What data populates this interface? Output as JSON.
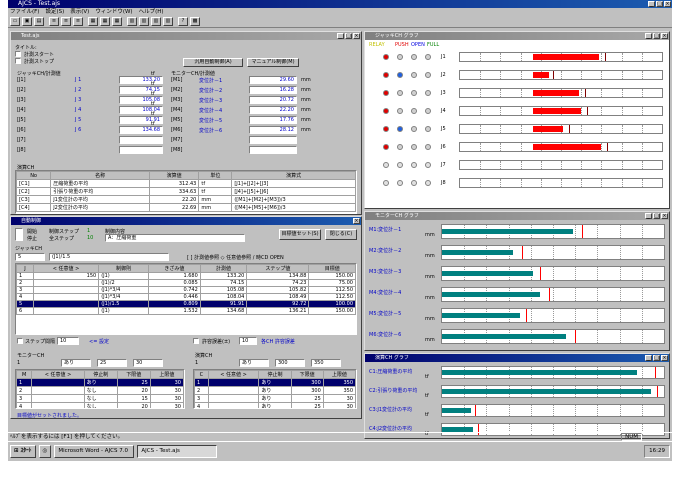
{
  "app": {
    "title": "AJCS - Test.ajs",
    "menus": [
      "ファイル(F)",
      "設定(S)",
      "表示(V)",
      "ウィンドウ(W)",
      "ヘルプ(H)"
    ]
  },
  "main_win": {
    "title": "Test.ajs",
    "label_title": "タイトル:",
    "buttons": {
      "start": "計測スタート",
      "stop": "計測ストップ",
      "auto": "汎用自動制御(A)",
      "manual": "マニュアル制御(M)"
    },
    "jack_header": "ジャッキCH/計測値",
    "monitor_header": "モニターCH/計測値",
    "jacks": [
      {
        "id": "[J1]",
        "name": "J 1",
        "value": "133.20",
        "unit": "tf"
      },
      {
        "id": "[J2]",
        "name": "J 2",
        "value": "74.15",
        "unit": "tf"
      },
      {
        "id": "[J3]",
        "name": "J 3",
        "value": "105.08",
        "unit": "tf"
      },
      {
        "id": "[J4]",
        "name": "J 4",
        "value": "108.04",
        "unit": "tf"
      },
      {
        "id": "[J5]",
        "name": "J 5",
        "value": "91.91",
        "unit": "tf"
      },
      {
        "id": "[J6]",
        "name": "J 6",
        "value": "134.68",
        "unit": "tf"
      },
      {
        "id": "[J7]",
        "name": "",
        "value": "",
        "unit": ""
      },
      {
        "id": "[J8]",
        "name": "",
        "value": "",
        "unit": ""
      }
    ],
    "monitors": [
      {
        "id": "[M1]",
        "name": "変位計－1",
        "value": "29.60",
        "unit": "mm"
      },
      {
        "id": "[M2]",
        "name": "変位計－2",
        "value": "16.28",
        "unit": "mm"
      },
      {
        "id": "[M3]",
        "name": "変位計－3",
        "value": "20.72",
        "unit": "mm"
      },
      {
        "id": "[M4]",
        "name": "変位計－4",
        "value": "22.20",
        "unit": "mm"
      },
      {
        "id": "[M5]",
        "name": "変位計－5",
        "value": "17.76",
        "unit": "mm"
      },
      {
        "id": "[M6]",
        "name": "変位計－6",
        "value": "28.12",
        "unit": "mm"
      },
      {
        "id": "[M7]",
        "name": "",
        "value": "",
        "unit": ""
      },
      {
        "id": "[M8]",
        "name": "",
        "value": "",
        "unit": ""
      }
    ],
    "calc_header": "演算CH",
    "calc_cols": [
      "No",
      "名称",
      "演算値",
      "単位",
      "演算式"
    ],
    "calc_rows": [
      [
        "[C1]",
        "圧縮荷重の平均",
        "312.43",
        "tf",
        "[J1]+[J2]+[J3]"
      ],
      [
        "[C2]",
        "引張り荷重の平均",
        "334.63",
        "tf",
        "[J4]+[J5]+[J6]"
      ],
      [
        "[C3]",
        "J1変位計の平均",
        "22.20",
        "mm",
        "([M1]+[M2]+[M3])/3"
      ],
      [
        "[C4]",
        "J2変位計の平均",
        "22.69",
        "mm",
        "([M4]+[M5]+[M6])/3"
      ]
    ]
  },
  "auto_win": {
    "title": "自動制御",
    "start": "開始",
    "stop": "停止",
    "mode_label": "制御ステップ",
    "step_label": "全ステップ",
    "step_cur": "1",
    "step_total": "10",
    "pattern_label": "制御内容",
    "pattern": "A：圧縮荷重",
    "target_btn": "目標値セット(S)",
    "close_btn": "閉じる(C)",
    "jack_ch": "ジャッキCH",
    "formula_no": "5",
    "formula": "(J1)/1.5",
    "options": "[ ] 計測値参照 ◇ 任意値参照 / 時CD OPEN",
    "cols": [
      "J",
      "< 任意値 >",
      "制御則",
      "きざみ値",
      "計測値",
      "ステップ値",
      "目標値"
    ],
    "rows": [
      [
        "1",
        "150",
        "(J1)",
        "1.680",
        "133.20",
        "134.88",
        "150.00"
      ],
      [
        "2",
        "",
        "(J1)/2",
        "0.085",
        "74.15",
        "74.23",
        "75.00"
      ],
      [
        "3",
        "",
        "(J1)*3/4",
        "0.742",
        "105.08",
        "105.82",
        "112.50"
      ],
      [
        "4",
        "",
        "(J1)*3/4",
        "0.446",
        "108.04",
        "108.49",
        "112.50"
      ],
      [
        "5",
        "",
        "(J1)/1.5",
        "0.809",
        "91.91",
        "92.72",
        "100.00"
      ],
      [
        "6",
        "",
        "(J1)",
        "1.532",
        "134.68",
        "136.21",
        "150.00"
      ]
    ],
    "step_chk": "ステップ間隔",
    "step_val": "10",
    "step_note": "<= 設定",
    "err_chk": "許容誤差(±)",
    "err_val": "10",
    "err_note": "各CH 許容誤差",
    "mon_hdr": "モニターCH",
    "mon_sel": "1",
    "mon_mode": "あり",
    "mon_lo": "25",
    "mon_hi": "30",
    "mon_cols": [
      "M",
      "< 任意値 >",
      "停止制",
      "下限値",
      "上限値"
    ],
    "mon_rows": [
      [
        "1",
        "",
        "あり",
        "25",
        "30"
      ],
      [
        "2",
        "",
        "なし",
        "20",
        "30"
      ],
      [
        "3",
        "",
        "なし",
        "15",
        "30"
      ],
      [
        "4",
        "",
        "なし",
        "20",
        "30"
      ],
      [
        "5",
        "",
        "なし",
        "15",
        "30"
      ]
    ],
    "calc_hdr": "演算CH",
    "calc_sel": "1",
    "calc_mode": "あり",
    "calc_lo": "300",
    "calc_hi": "350",
    "calc_cols": [
      "C",
      "< 任意値 >",
      "停止制",
      "下限値",
      "上限値"
    ],
    "calc_rows": [
      [
        "1",
        "",
        "あり",
        "300",
        "350"
      ],
      [
        "2",
        "",
        "あり",
        "300",
        "350"
      ],
      [
        "3",
        "",
        "あり",
        "25",
        "30"
      ],
      [
        "4",
        "",
        "あり",
        "25",
        "30"
      ]
    ],
    "status_msg": "目標値がセットされました。"
  },
  "jack_graph": {
    "title": "ジャッキCH グラフ",
    "legend": [
      "RELAY",
      "PUSH",
      "OPEN",
      "FULL"
    ],
    "rows": [
      {
        "id": "J1",
        "value": 0.69,
        "mark": 0.72
      },
      {
        "id": "J2",
        "value": 0.44,
        "mark": 0.46
      },
      {
        "id": "J3",
        "value": 0.59,
        "mark": 0.62
      },
      {
        "id": "J4",
        "value": 0.6,
        "mark": 0.63
      },
      {
        "id": "J5",
        "value": 0.51,
        "mark": 0.54
      },
      {
        "id": "J6",
        "value": 0.7,
        "mark": 0.73
      },
      {
        "id": "J7",
        "value": 0,
        "mark": 0
      },
      {
        "id": "J8",
        "value": 0,
        "mark": 0
      }
    ]
  },
  "mon_graph": {
    "title": "モニターCH グラフ",
    "unit": "mm",
    "rows": [
      {
        "name": "M1:変位計－1",
        "value": 0.59,
        "mark": 0.63
      },
      {
        "name": "M2:変位計－2",
        "value": 0.32,
        "mark": 0.36
      },
      {
        "name": "M3:変位計－3",
        "value": 0.41,
        "mark": 0.44
      },
      {
        "name": "M4:変位計－4",
        "value": 0.44,
        "mark": 0.48
      },
      {
        "name": "M5:変位計－5",
        "value": 0.35,
        "mark": 0.38
      },
      {
        "name": "M6:変位計－6",
        "value": 0.56,
        "mark": 0.6
      }
    ]
  },
  "calc_graph": {
    "title": "演算CH グラフ",
    "unit": "tf",
    "rows": [
      {
        "name": "C1:圧縮荷重の平均",
        "value": 0.88,
        "mark": 0.96
      },
      {
        "name": "C2:引張り荷重の平均",
        "value": 0.94,
        "mark": 0.97
      },
      {
        "name": "C3:J1変位計の平均",
        "value": 0.13,
        "mark": 0.15
      },
      {
        "name": "C4:J2変位計の平均",
        "value": 0.14,
        "mark": 0.16
      }
    ]
  },
  "status_bar": {
    "text": "ﾍﾙﾌﾟを表示するには [F1] を押してください。",
    "num": "NUM"
  },
  "taskbar": {
    "start": "ｽﾀｰﾄ",
    "tasks": [
      "Microsoft Word - AJCS 7.0",
      "AJCS - Test.ajs"
    ],
    "clock": "16:29"
  }
}
